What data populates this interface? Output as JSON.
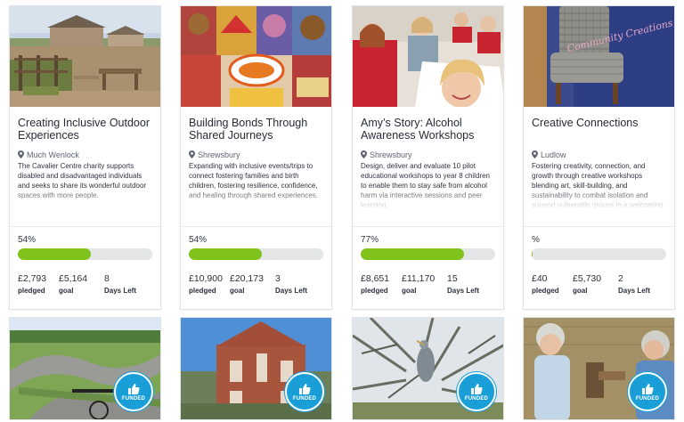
{
  "colors": {
    "progress_fill": "#7fc31c",
    "progress_track": "#e4e5e7",
    "funded_badge": "#1a9ed8"
  },
  "cards": [
    {
      "title": "Creating Inclusive Outdoor Experiences",
      "location": "Much Wenlock",
      "description": "The Cavalier Centre charity supports disabled and disadvantaged individuals and seeks to share its wonderful outdoor spaces with more people.",
      "percent_label": "54%",
      "progress": 54,
      "pledged": "£2,793",
      "goal": "£5,164",
      "days": "8",
      "pledged_label": "pledged",
      "goal_label": "goal",
      "days_label": "Days Left",
      "image_icon": "farm-photo"
    },
    {
      "title": "Building Bonds Through Shared Journeys",
      "location": "Shrewsbury",
      "description": "Expanding with inclusive events/trips to connect fostering families and birth children, fostering resilience, confidence, and healing through shared experiences.",
      "percent_label": "54%",
      "progress": 54,
      "pledged": "£10,900",
      "goal": "£20,173",
      "days": "3",
      "pledged_label": "pledged",
      "goal_label": "goal",
      "days_label": "Days Left",
      "image_icon": "event-collage-photo"
    },
    {
      "title": "Amy’s Story: Alcohol Awareness Workshops",
      "location": "Shrewsbury",
      "description": "Design, deliver and evaluate 10 pilot educational workshops to year 8 children to enable them to stay safe from alcohol harm via interactive sessions and peer learning.",
      "percent_label": "77%",
      "progress": 77,
      "pledged": "£8,651",
      "goal": "£11,170",
      "days": "15",
      "pledged_label": "pledged",
      "goal_label": "goal",
      "days_label": "Days Left",
      "image_icon": "classroom-photo"
    },
    {
      "title": "Creative Connections",
      "location": "Ludlow",
      "description": "Fostering creativity, connection, and growth through creative workshops blending art, skill-building, and sustainability to combat isolation and support vulnerable groups in a welcoming space.",
      "percent_label": "%",
      "progress": 0.7,
      "pledged": "£40",
      "goal": "£5,730",
      "days": "2",
      "pledged_label": "pledged",
      "goal_label": "goal",
      "days_label": "Days Left",
      "image_icon": "upholstered-chair-photo",
      "image_text": "Community Creations"
    }
  ],
  "funded": [
    {
      "label": "FUNDED",
      "image_icon": "pump-track-photo"
    },
    {
      "label": "FUNDED",
      "image_icon": "brick-building-photo"
    },
    {
      "label": "FUNDED",
      "image_icon": "heron-photo"
    },
    {
      "label": "FUNDED",
      "image_icon": "garden-volunteers-photo"
    }
  ]
}
